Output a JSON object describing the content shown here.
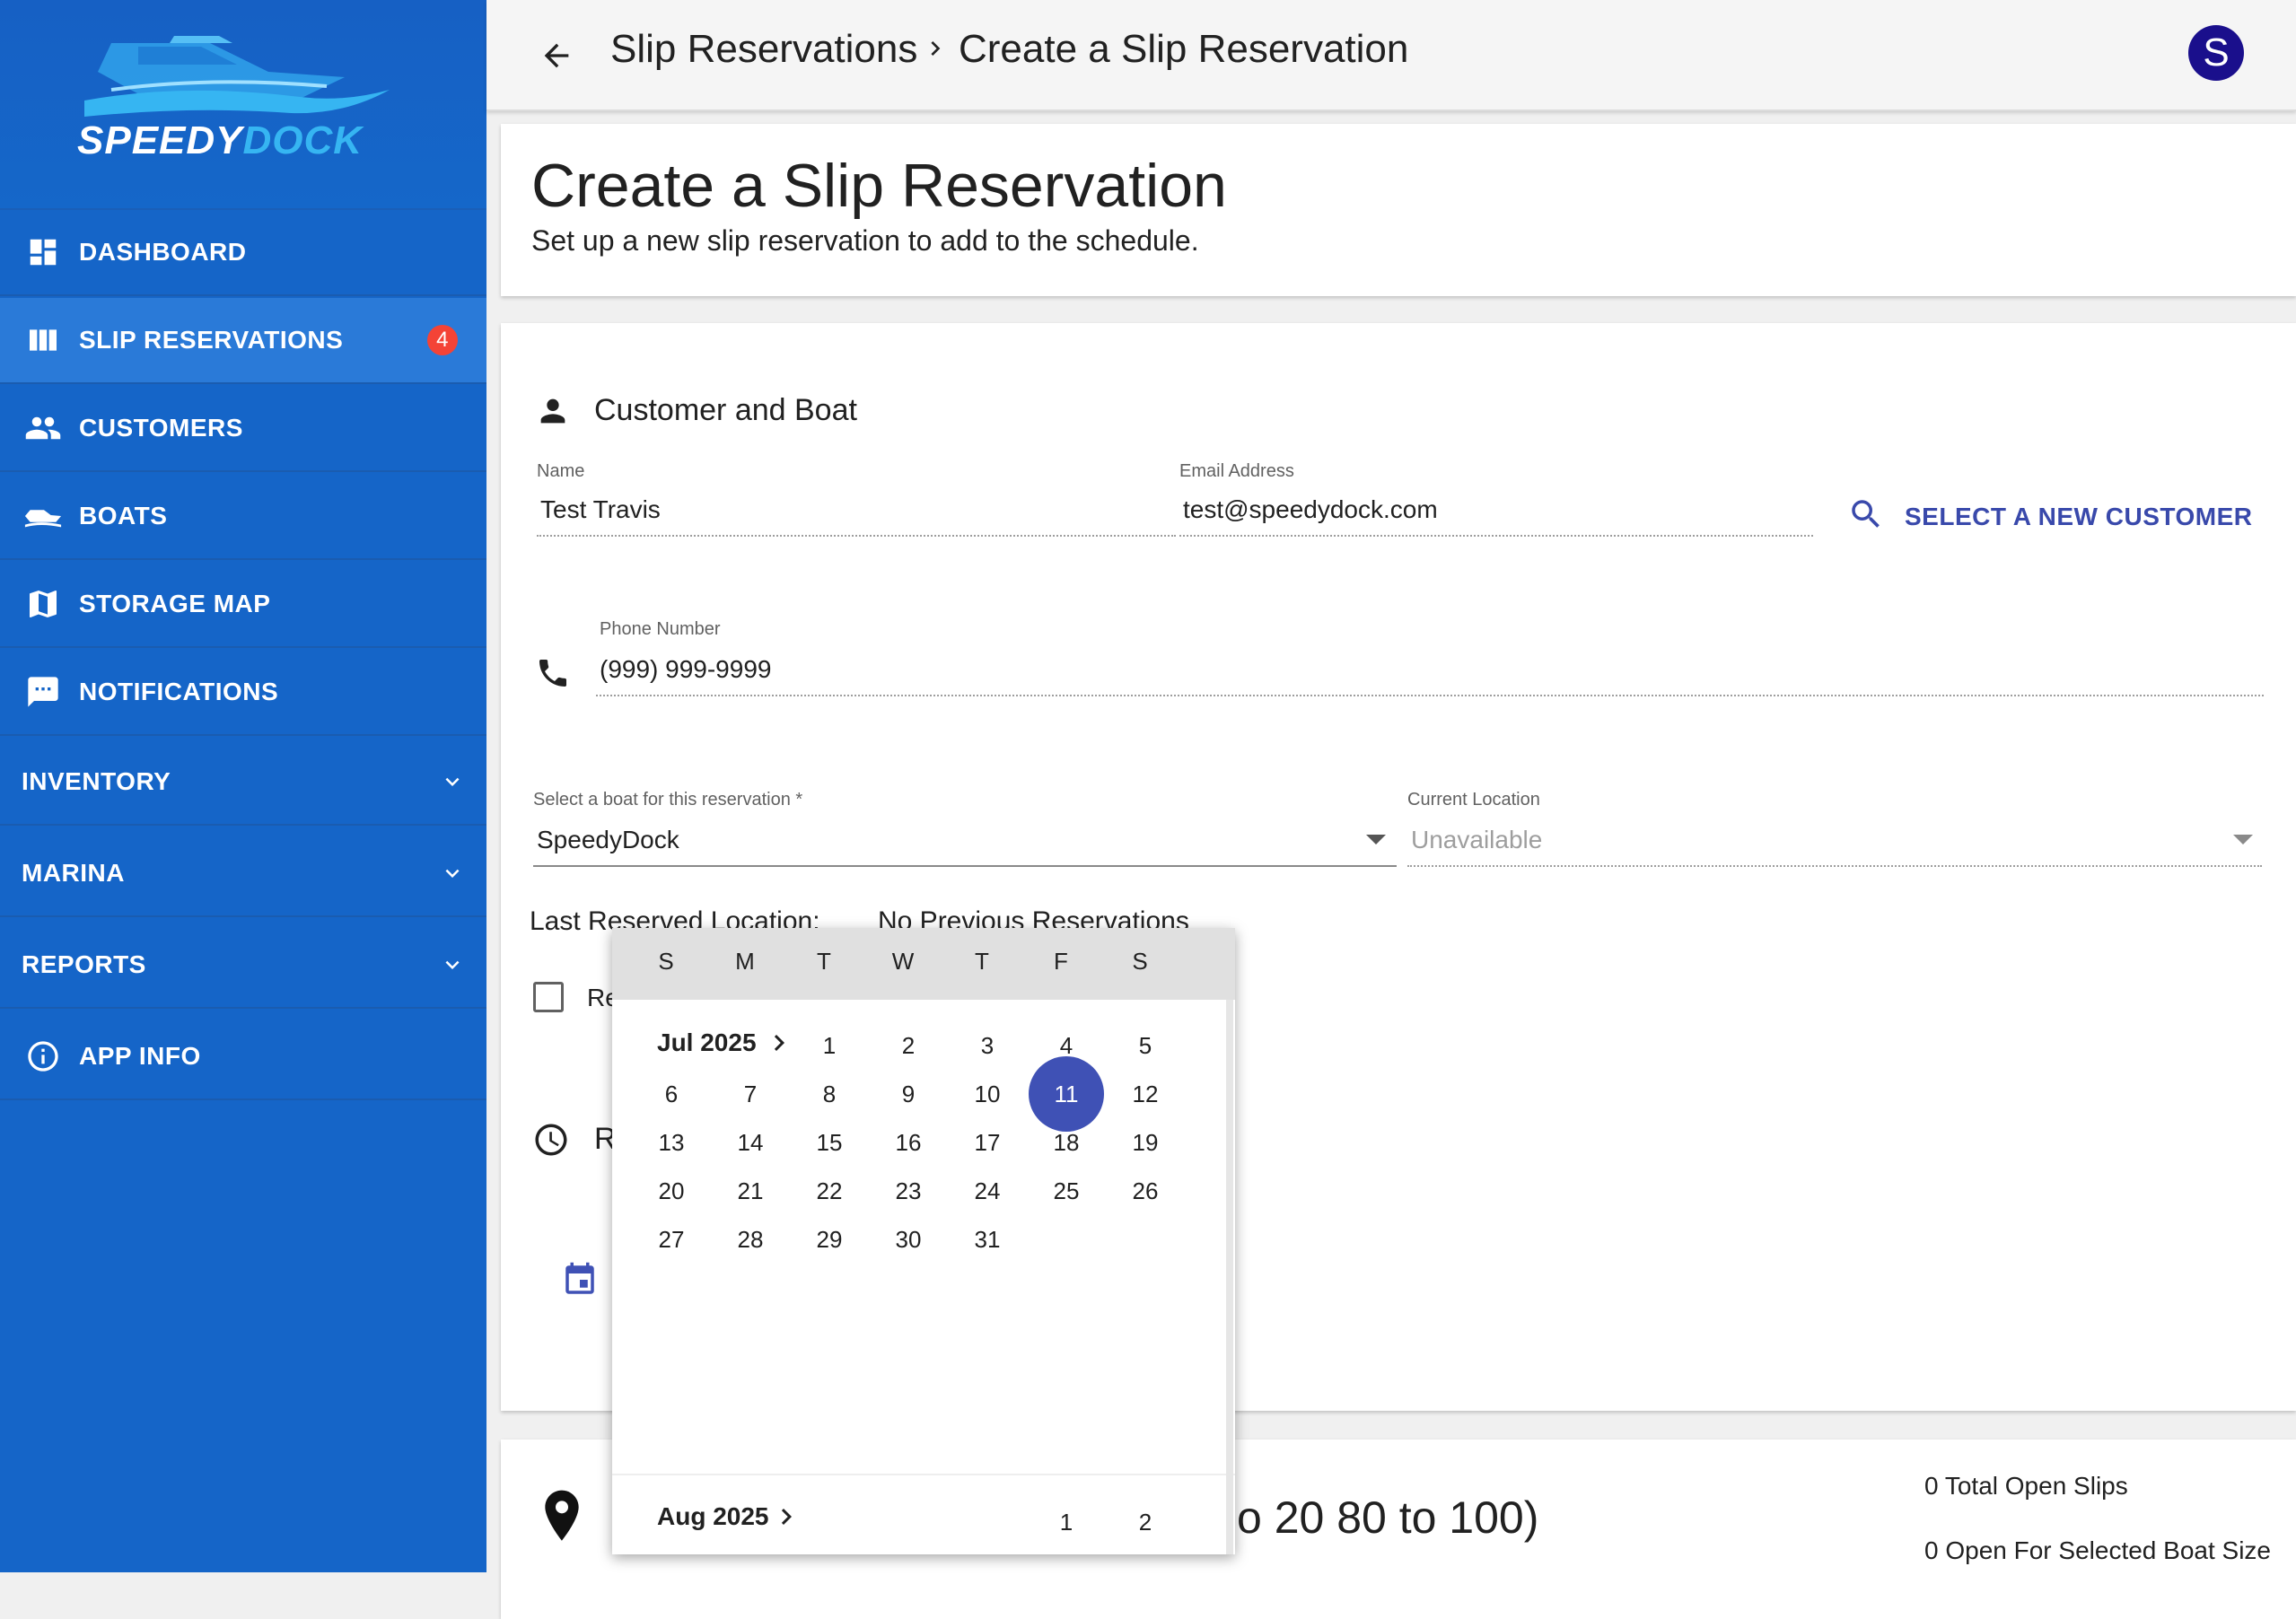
{
  "sidebar": {
    "logo": {
      "part1": "SPEEDY",
      "part2": "DOCK"
    },
    "items": [
      {
        "label": "DASHBOARD",
        "icon": "dashboard-icon"
      },
      {
        "label": "SLIP RESERVATIONS",
        "icon": "view-columns-icon",
        "badge": "4",
        "active": true
      },
      {
        "label": "CUSTOMERS",
        "icon": "people-icon"
      },
      {
        "label": "BOATS",
        "icon": "boat-icon"
      },
      {
        "label": "STORAGE MAP",
        "icon": "map-icon"
      },
      {
        "label": "NOTIFICATIONS",
        "icon": "message-icon"
      },
      {
        "label": "INVENTORY",
        "icon": "chevron-down-icon"
      },
      {
        "label": "MARINA",
        "icon": "chevron-down-icon"
      },
      {
        "label": "REPORTS",
        "icon": "chevron-down-icon"
      },
      {
        "label": "APP INFO",
        "icon": "info-icon"
      }
    ]
  },
  "topbar": {
    "breadcrumb": [
      "Slip Reservations",
      "Create a Slip Reservation"
    ],
    "avatar_letter": "S"
  },
  "header": {
    "title": "Create a Slip Reservation",
    "subtitle": "Set up a new slip reservation to add to the schedule."
  },
  "customer_section": {
    "title": "Customer and Boat",
    "name_label": "Name",
    "name_value": "Test Travis",
    "email_label": "Email Address",
    "email_value": "test@speedydock.com",
    "select_customer_label": "SELECT A NEW CUSTOMER",
    "phone_label": "Phone Number",
    "phone_value": "(999) 999-9999",
    "boat_label": "Select a boat for this reservation *",
    "boat_value": "SpeedyDock",
    "location_label": "Current Location",
    "location_value": "Unavailable",
    "last_location_label": "Last Reserved Location:",
    "last_location_value": "No Previous Reservations",
    "checkbox_label_partial": "Re",
    "reservation_partial": "R"
  },
  "slips_section": {
    "title_partial": "o 20 80 to 100)",
    "total_open": "0 Total Open Slips",
    "open_for_size": "0 Open For Selected Boat Size"
  },
  "calendar": {
    "weekdays": [
      "S",
      "M",
      "T",
      "W",
      "T",
      "F",
      "S"
    ],
    "month1": "Jul 2025",
    "month2": "Aug 2025",
    "selected_day": "11",
    "july_weeks": [
      [
        "",
        "",
        "1",
        "2",
        "3",
        "4",
        "5"
      ],
      [
        "6",
        "7",
        "8",
        "9",
        "10",
        "11",
        "12"
      ],
      [
        "13",
        "14",
        "15",
        "16",
        "17",
        "18",
        "19"
      ],
      [
        "20",
        "21",
        "22",
        "23",
        "24",
        "25",
        "26"
      ],
      [
        "27",
        "28",
        "29",
        "30",
        "31",
        "",
        ""
      ]
    ],
    "aug_first_week": [
      "",
      "",
      "",
      "",
      "",
      "1",
      "2"
    ]
  },
  "colors": {
    "sidebar": "#1565c8",
    "accent": "#3f51b5",
    "badge": "#f44336",
    "avatar": "#1a0f8c",
    "link": "#3949ab"
  }
}
